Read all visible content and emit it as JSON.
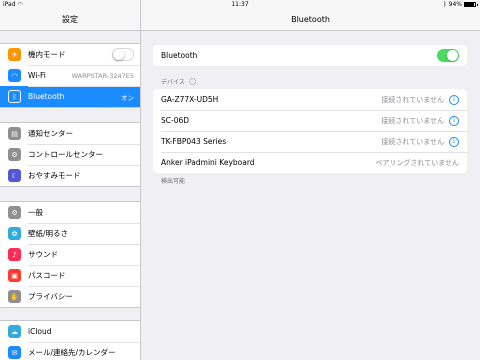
{
  "status": {
    "device": "iPad",
    "wifi_icon": "wifi-icon",
    "time": "11:37",
    "bluetooth_icon": "bluetooth-icon",
    "battery": "94%",
    "battery_level": 0.94
  },
  "master": {
    "title": "設定",
    "groups": [
      {
        "items": [
          {
            "label": "機内モード",
            "icon": "airplane-icon",
            "icon_color": "#ff9500",
            "glyph": "✈",
            "toggle": false
          },
          {
            "label": "Wi-Fi",
            "icon": "wifi-icon",
            "icon_color": "#1a8cff",
            "glyph": "◠",
            "value": "WARPSTAR-3247E5"
          },
          {
            "label": "Bluetooth",
            "icon": "bluetooth-icon",
            "icon_color": "#1a8cff",
            "glyph": "ᛒ",
            "value": "オン",
            "selected": true
          }
        ]
      },
      {
        "items": [
          {
            "label": "通知センター",
            "icon": "notification-center-icon",
            "icon_color": "#8e8e93",
            "glyph": "▤"
          },
          {
            "label": "コントロールセンター",
            "icon": "control-center-icon",
            "icon_color": "#8e8e93",
            "glyph": "⚙"
          },
          {
            "label": "おやすみモード",
            "icon": "moon-icon",
            "icon_color": "#5856d6",
            "glyph": "☾"
          }
        ]
      },
      {
        "items": [
          {
            "label": "一般",
            "icon": "gear-icon",
            "icon_color": "#8e8e93",
            "glyph": "⚙"
          },
          {
            "label": "壁紙/明るさ",
            "icon": "wallpaper-icon",
            "icon_color": "#34aadc",
            "glyph": "✿"
          },
          {
            "label": "サウンド",
            "icon": "sound-icon",
            "icon_color": "#ff2d55",
            "glyph": "♪"
          },
          {
            "label": "パスコード",
            "icon": "lock-icon",
            "icon_color": "#ff3b30",
            "glyph": "▣"
          },
          {
            "label": "プライバシー",
            "icon": "hand-icon",
            "icon_color": "#8e8e93",
            "glyph": "✋"
          }
        ]
      },
      {
        "items": [
          {
            "label": "iCloud",
            "icon": "cloud-icon",
            "icon_color": "#34aadc",
            "glyph": "☁"
          },
          {
            "label": "メール/連絡先/カレンダー",
            "icon": "mail-icon",
            "icon_color": "#1a8cff",
            "glyph": "✉"
          }
        ]
      }
    ]
  },
  "detail": {
    "title": "Bluetooth",
    "bluetooth_label": "Bluetooth",
    "bluetooth_on": true,
    "devices_header": "デバイス",
    "devices": [
      {
        "name": "GA-Z77X-UD5H",
        "status": "接続されていません",
        "info": true
      },
      {
        "name": "SC-06D",
        "status": "接続されていません",
        "info": true
      },
      {
        "name": "TK-FBP043 Series",
        "status": "接続されていません",
        "info": true
      },
      {
        "name": "Anker iPadmini Keyboard",
        "status": "ペアリングされていません",
        "info": false
      }
    ],
    "footer": "検出可能",
    "info_glyph": "i"
  }
}
